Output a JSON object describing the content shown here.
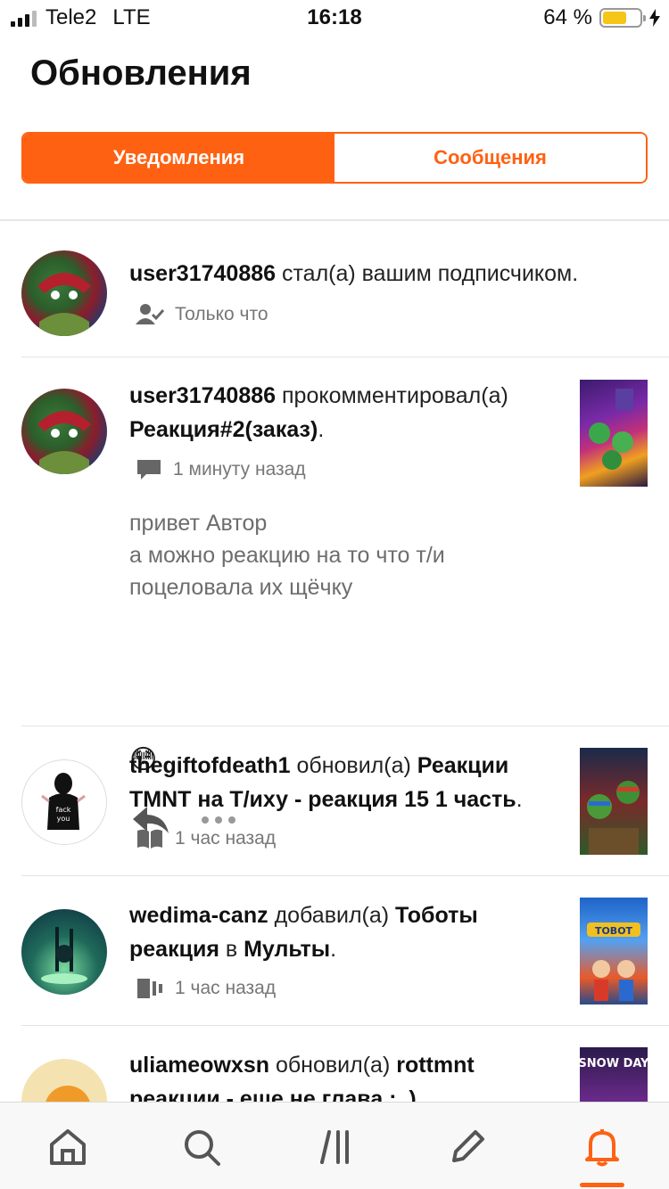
{
  "status_bar": {
    "carrier": "Tele2",
    "network": "LTE",
    "time": "16:18",
    "battery": "64 %"
  },
  "header": {
    "title": "Обновления"
  },
  "tabs": {
    "notifications": "Уведомления",
    "messages": "Сообщения"
  },
  "colors": {
    "accent": "#ff6112",
    "text": "#222222",
    "muted": "#777777"
  },
  "feed": [
    {
      "user": "user31740886",
      "action": "стал(а) вашим подписчиком.",
      "time": "Только что",
      "icon": "user-check-icon"
    },
    {
      "user": "user31740886",
      "action": "прокомментировал(а)",
      "target": "Реакция#2(заказ)",
      "suffix": ".",
      "time": "1 минуту назад",
      "icon": "comment-icon",
      "comment_lines": [
        "привет Автор",
        "а можно реакцию на то что т/и",
        "поцеловала их щёчку"
      ],
      "emoji": "😳"
    },
    {
      "user": "thegiftofdeath1",
      "action": "обновил(а)",
      "target_line1": "Реакции",
      "target_line2": "TMNT на Т/иху - реакция 15 1 часть",
      "suffix": ".",
      "time": "1 час назад",
      "icon": "book-icon",
      "avatar_text": "fack you"
    },
    {
      "user": "wedima-canz",
      "action": "добавил(а)",
      "target_line1": "Тоботы",
      "target_line2a": "реакция",
      "mid": "в",
      "target_line2b": "Мульты",
      "suffix": ".",
      "time": "1 час назад",
      "icon": "collection-icon",
      "thumb_text": "TOBOT"
    },
    {
      "user": "uliameowxsn",
      "action": "обновил(а)",
      "target": "rottmnt",
      "line2": "реакции - еще не глава :_)",
      "thumb_text": "SNOW DAY"
    }
  ],
  "nav": [
    "home-icon",
    "search-icon",
    "library-icon",
    "write-icon",
    "bell-icon"
  ]
}
